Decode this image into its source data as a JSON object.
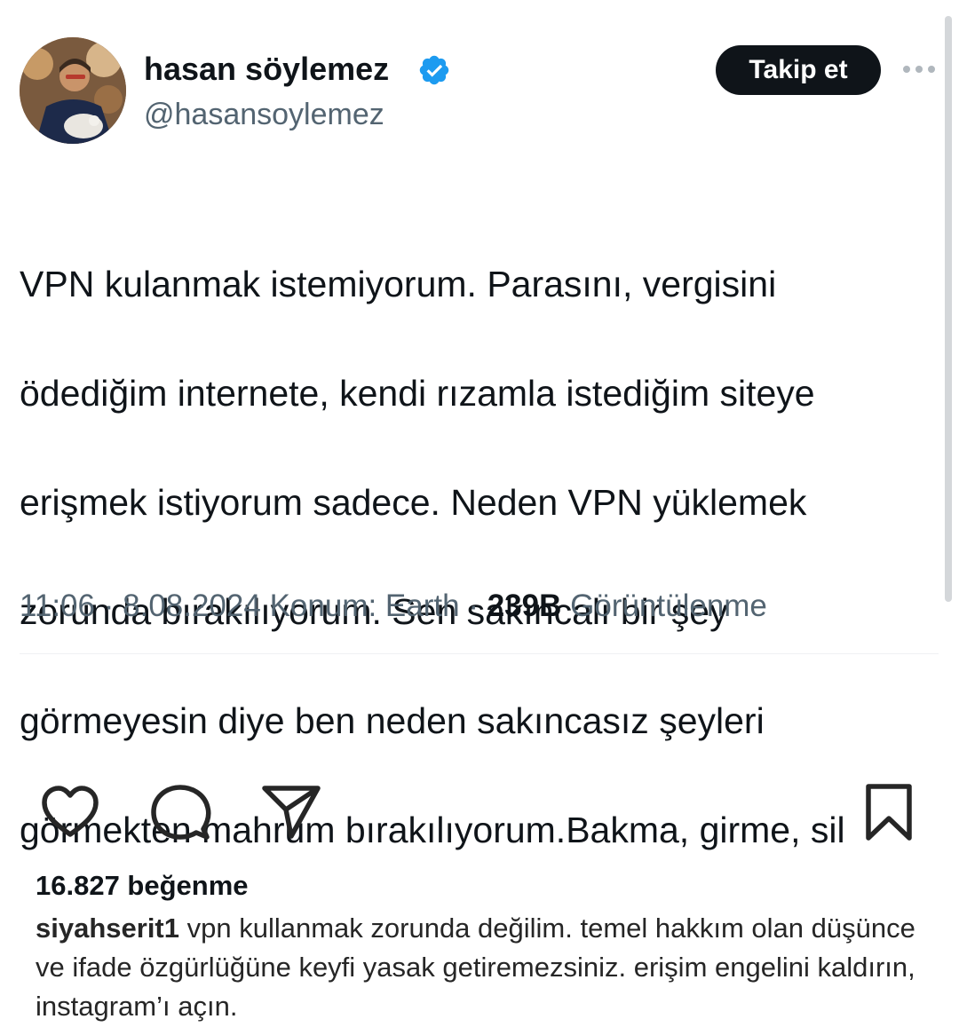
{
  "tweet": {
    "display_name": "hasan söylemez",
    "handle": "@hasansoylemez",
    "follow_label": "Takip et",
    "text_lines": [
      "VPN kulanmak istemiyorum. Parasını, vergisini",
      "ödediğim internete, kendi rızamla istediğim siteye",
      "erişmek istiyorum sadece. Neden VPN yüklemek",
      "zorunda bırakılıyorum. Sen sakıncalı bir şey",
      "görmeyesin diye ben neden sakıncasız şeyleri",
      "görmekten mahrum bırakılıyorum.Bakma, girme, sil"
    ],
    "time": "11:06",
    "separator": "·",
    "date": "8.08.2024",
    "location": "Konum: Earth",
    "views_count": "239B",
    "views_label": "Görüntülenme",
    "icons": {
      "verified": "verified-badge-icon",
      "more": "more-options-icon"
    },
    "colors": {
      "verified": "#1d9bf0",
      "button_bg": "#0f1419",
      "secondary_text": "#536471"
    }
  },
  "instagram": {
    "likes": "16.827 beğenme",
    "caption_user": "siyahserit1",
    "caption_text": "vpn kullanmak zorunda değilim. temel hakkım olan düşünce ve ifade özgürlüğüne keyfi yasak getiremezsiniz. erişim engelini kaldırın, instagram’ı açın.",
    "icons": [
      "heart-icon",
      "comment-icon",
      "share-icon",
      "bookmark-icon"
    ]
  }
}
